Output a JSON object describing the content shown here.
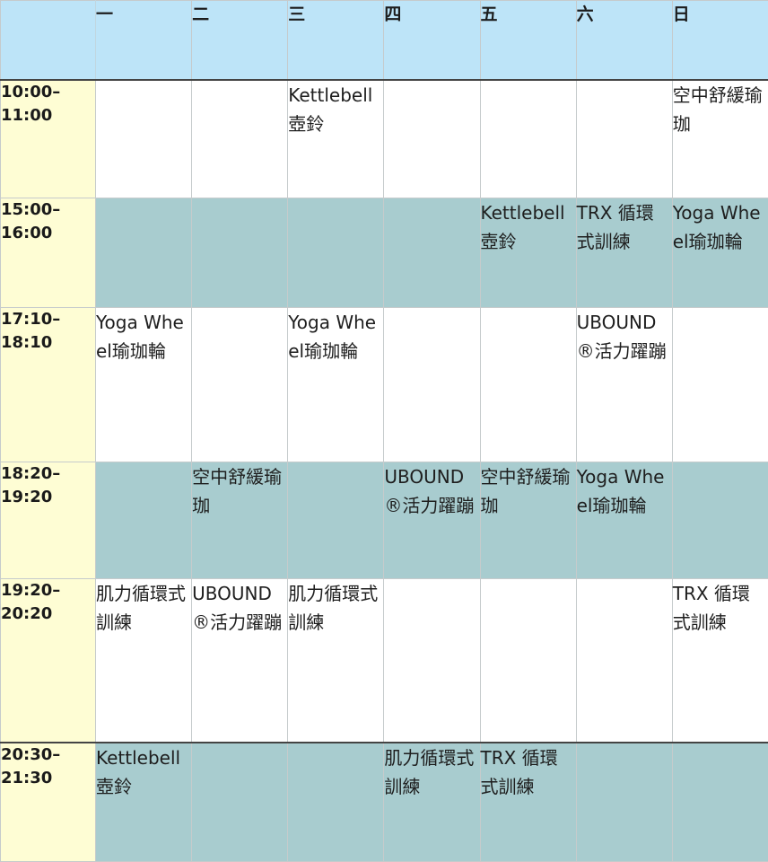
{
  "header": {
    "corner": "",
    "days": [
      "一",
      "二",
      "三",
      "四",
      "五",
      "六",
      "日"
    ]
  },
  "rows": [
    {
      "time": [
        "10:00–",
        "11:00"
      ],
      "cells": [
        "",
        "",
        "Kettlebell 壺鈴",
        "",
        "",
        "",
        "空中舒緩瑜珈"
      ]
    },
    {
      "time": [
        "15:00–",
        "16:00"
      ],
      "cells": [
        "",
        "",
        "",
        "",
        "Kettlebell 壺鈴",
        "TRX 循環式訓練",
        "Yoga Wheel瑜珈輪"
      ]
    },
    {
      "time": [
        "17:10–",
        "18:10"
      ],
      "cells": [
        "Yoga Wheel瑜珈輪",
        "",
        "Yoga Wheel瑜珈輪",
        "",
        "",
        "UBOUND®活力躍蹦",
        ""
      ]
    },
    {
      "time": [
        "18:20–",
        "19:20"
      ],
      "cells": [
        "",
        "空中舒緩瑜珈",
        "",
        "UBOUND®活力躍蹦",
        "空中舒緩瑜珈",
        "Yoga Wheel瑜珈輪",
        ""
      ]
    },
    {
      "time": [
        "19:20–",
        "20:20"
      ],
      "cells": [
        "肌力循環式訓練",
        "UBOUND®活力躍蹦",
        "肌力循環式訓練",
        "",
        "",
        "",
        "TRX 循環式訓練"
      ]
    },
    {
      "time": [
        "20:30–",
        "21:30"
      ],
      "cells": [
        "Kettlebell 壺鈴",
        "",
        "",
        "肌力循環式訓練",
        "TRX 循環式訓練",
        "",
        ""
      ]
    }
  ],
  "colors": {
    "header_bg": "#bde4f8",
    "time_bg": "#fefdd4",
    "band_bg": "#a8cccf",
    "plain_bg": "#ffffff"
  }
}
